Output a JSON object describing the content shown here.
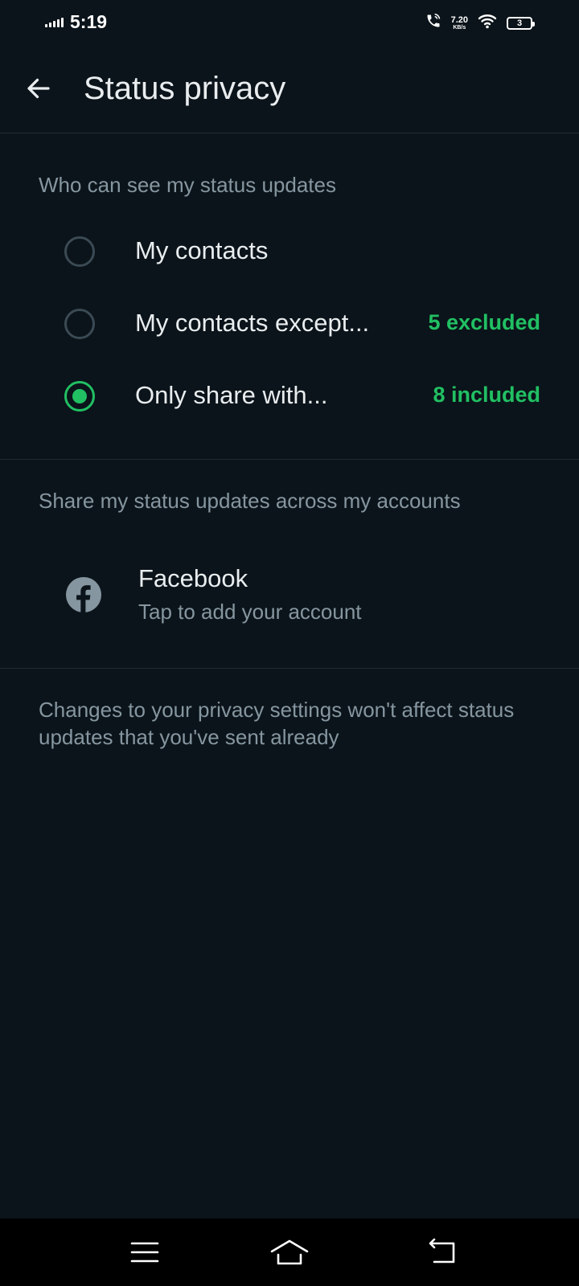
{
  "status_bar": {
    "time": "5:19",
    "speed_value": "7.20",
    "speed_unit": "KB/s",
    "battery": "3",
    "icons": [
      "signal-icon",
      "wifi-call-icon",
      "wifi-icon",
      "battery-icon"
    ]
  },
  "app_bar": {
    "title": "Status privacy",
    "back_icon": "arrow-left-icon"
  },
  "who_can_see": {
    "header": "Who can see my status updates",
    "options": [
      {
        "label": "My contacts",
        "count": "",
        "selected": false
      },
      {
        "label": "My contacts except...",
        "count": "5 excluded",
        "selected": false
      },
      {
        "label": "Only share with...",
        "count": "8 included",
        "selected": true
      }
    ]
  },
  "share_across": {
    "header": "Share my status updates across my accounts",
    "facebook": {
      "title": "Facebook",
      "subtitle": "Tap to add your account",
      "icon": "facebook-icon"
    }
  },
  "footnote": "Changes to your privacy settings won't affect status updates that you've sent already",
  "nav_bar": {
    "icons": [
      "menu-icon",
      "home-icon",
      "back-icon"
    ]
  },
  "colors": {
    "background": "#0b141a",
    "accent": "#21c063",
    "text_primary": "#e9edef",
    "text_secondary": "#8696a0",
    "divider": "#1f2c33"
  }
}
